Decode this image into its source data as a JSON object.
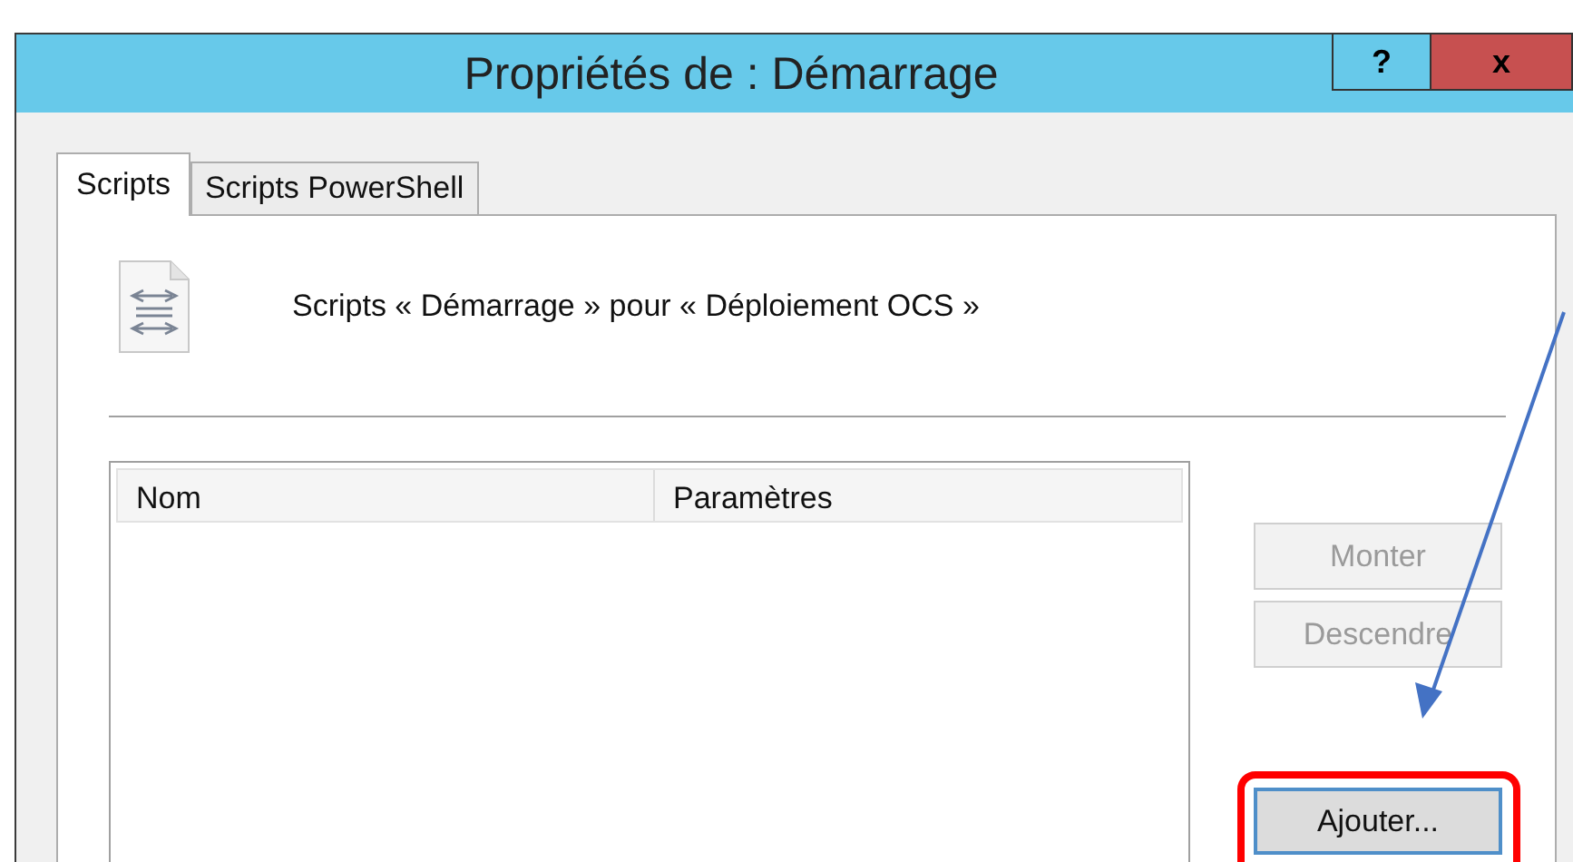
{
  "window": {
    "title": "Propriétés de : Démarrage",
    "title_buttons": [
      "?",
      "x"
    ]
  },
  "tabs": [
    {
      "label": "Scripts",
      "selected": true
    },
    {
      "label": "Scripts PowerShell",
      "selected": false
    }
  ],
  "header": {
    "text": "Scripts « Démarrage » pour « Déploiement OCS »"
  },
  "table": {
    "columns": [
      "Nom",
      "Paramètres"
    ]
  },
  "buttons": [
    {
      "label": "Monter",
      "disabled": true
    },
    {
      "label": "Descendre",
      "disabled": true
    },
    {
      "label": "Ajouter...",
      "disabled": false,
      "highlighted": true
    }
  ]
}
